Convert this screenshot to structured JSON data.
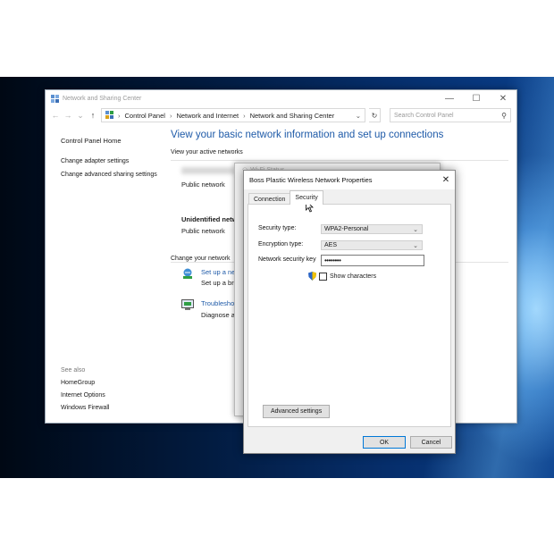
{
  "window": {
    "title": "Network and Sharing Center",
    "minimize": "—",
    "maximize": "☐",
    "close": "✕"
  },
  "address_bar": {
    "breadcrumbs": [
      "Control Panel",
      "Network and Internet",
      "Network and Sharing Center"
    ],
    "search_placeholder": "Search Control Panel"
  },
  "sidebar": {
    "home": "Control Panel Home",
    "items": [
      "Change adapter settings",
      "Change advanced sharing settings"
    ],
    "see_also_label": "See also",
    "see_also": [
      "HomeGroup",
      "Internet Options",
      "Windows Firewall"
    ]
  },
  "main": {
    "heading": "View your basic network information and set up connections",
    "active_networks_label": "View your active networks",
    "network1_type": "Public network",
    "network2_name": "Unidentified netw",
    "network2_type": "Public network",
    "change_label": "Change your network",
    "setup_link": "Set up a new",
    "setup_desc": "Set up a bro",
    "troubleshoot_link": "Troubleshoo",
    "troubleshoot_desc": "Diagnose an"
  },
  "status_dialog": {
    "title": "Wi-Fi Status"
  },
  "properties_dialog": {
    "title": "Boss Plastic Wireless Network Properties",
    "close": "✕",
    "tabs": [
      "Connection",
      "Security"
    ],
    "active_tab": "Security",
    "security_type_label": "Security type:",
    "security_type_value": "WPA2-Personal",
    "encryption_type_label": "Encryption type:",
    "encryption_type_value": "AES",
    "key_label": "Network security key",
    "key_value": "••••••••",
    "show_characters_label": "Show characters",
    "show_characters_checked": false,
    "advanced_button": "Advanced settings",
    "ok_button": "OK",
    "cancel_button": "Cancel"
  },
  "colors": {
    "link": "#1e5aa8",
    "ok_border": "#0078d7"
  }
}
